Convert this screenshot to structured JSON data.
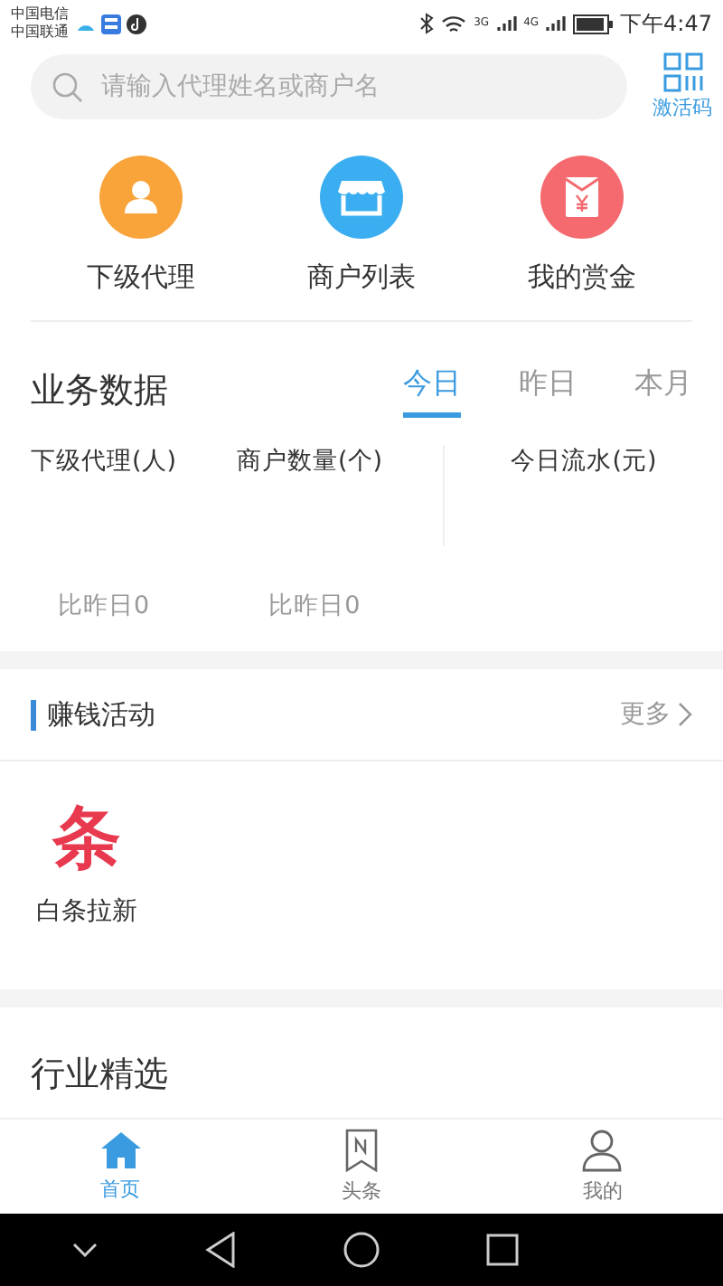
{
  "status_bar": {
    "carriers": [
      "中国电信",
      "中国联通"
    ],
    "network_labels": [
      "3G",
      "4G"
    ],
    "time": "下午4:47"
  },
  "search": {
    "placeholder": "请输入代理姓名或商户名",
    "action_label": "激活码"
  },
  "shortcuts": [
    {
      "label": "下级代理",
      "kind": "person",
      "color": "#f9a43a"
    },
    {
      "label": "商户列表",
      "kind": "shop",
      "color": "#3aaef0"
    },
    {
      "label": "我的赏金",
      "kind": "envelope",
      "color": "#f46a6f"
    }
  ],
  "business": {
    "title": "业务数据",
    "tabs": [
      {
        "label": "今日",
        "selected": true
      },
      {
        "label": "昨日",
        "selected": false
      },
      {
        "label": "本月",
        "selected": false
      }
    ],
    "stats": [
      {
        "label": "下级代理(人)",
        "compare": "比昨日0"
      },
      {
        "label": "商户数量(个)",
        "compare": "比昨日0"
      }
    ],
    "flow_label": "今日流水(元)"
  },
  "activities": {
    "title": "赚钱活动",
    "more": "更多",
    "items": [
      {
        "glyph": "条",
        "label": "白条拉新"
      }
    ]
  },
  "featured": {
    "title": "行业精选"
  },
  "tab_bar": [
    {
      "label": "首页",
      "kind": "home",
      "selected": true
    },
    {
      "label": "头条",
      "kind": "news",
      "selected": false
    },
    {
      "label": "我的",
      "kind": "profile",
      "selected": false
    }
  ]
}
